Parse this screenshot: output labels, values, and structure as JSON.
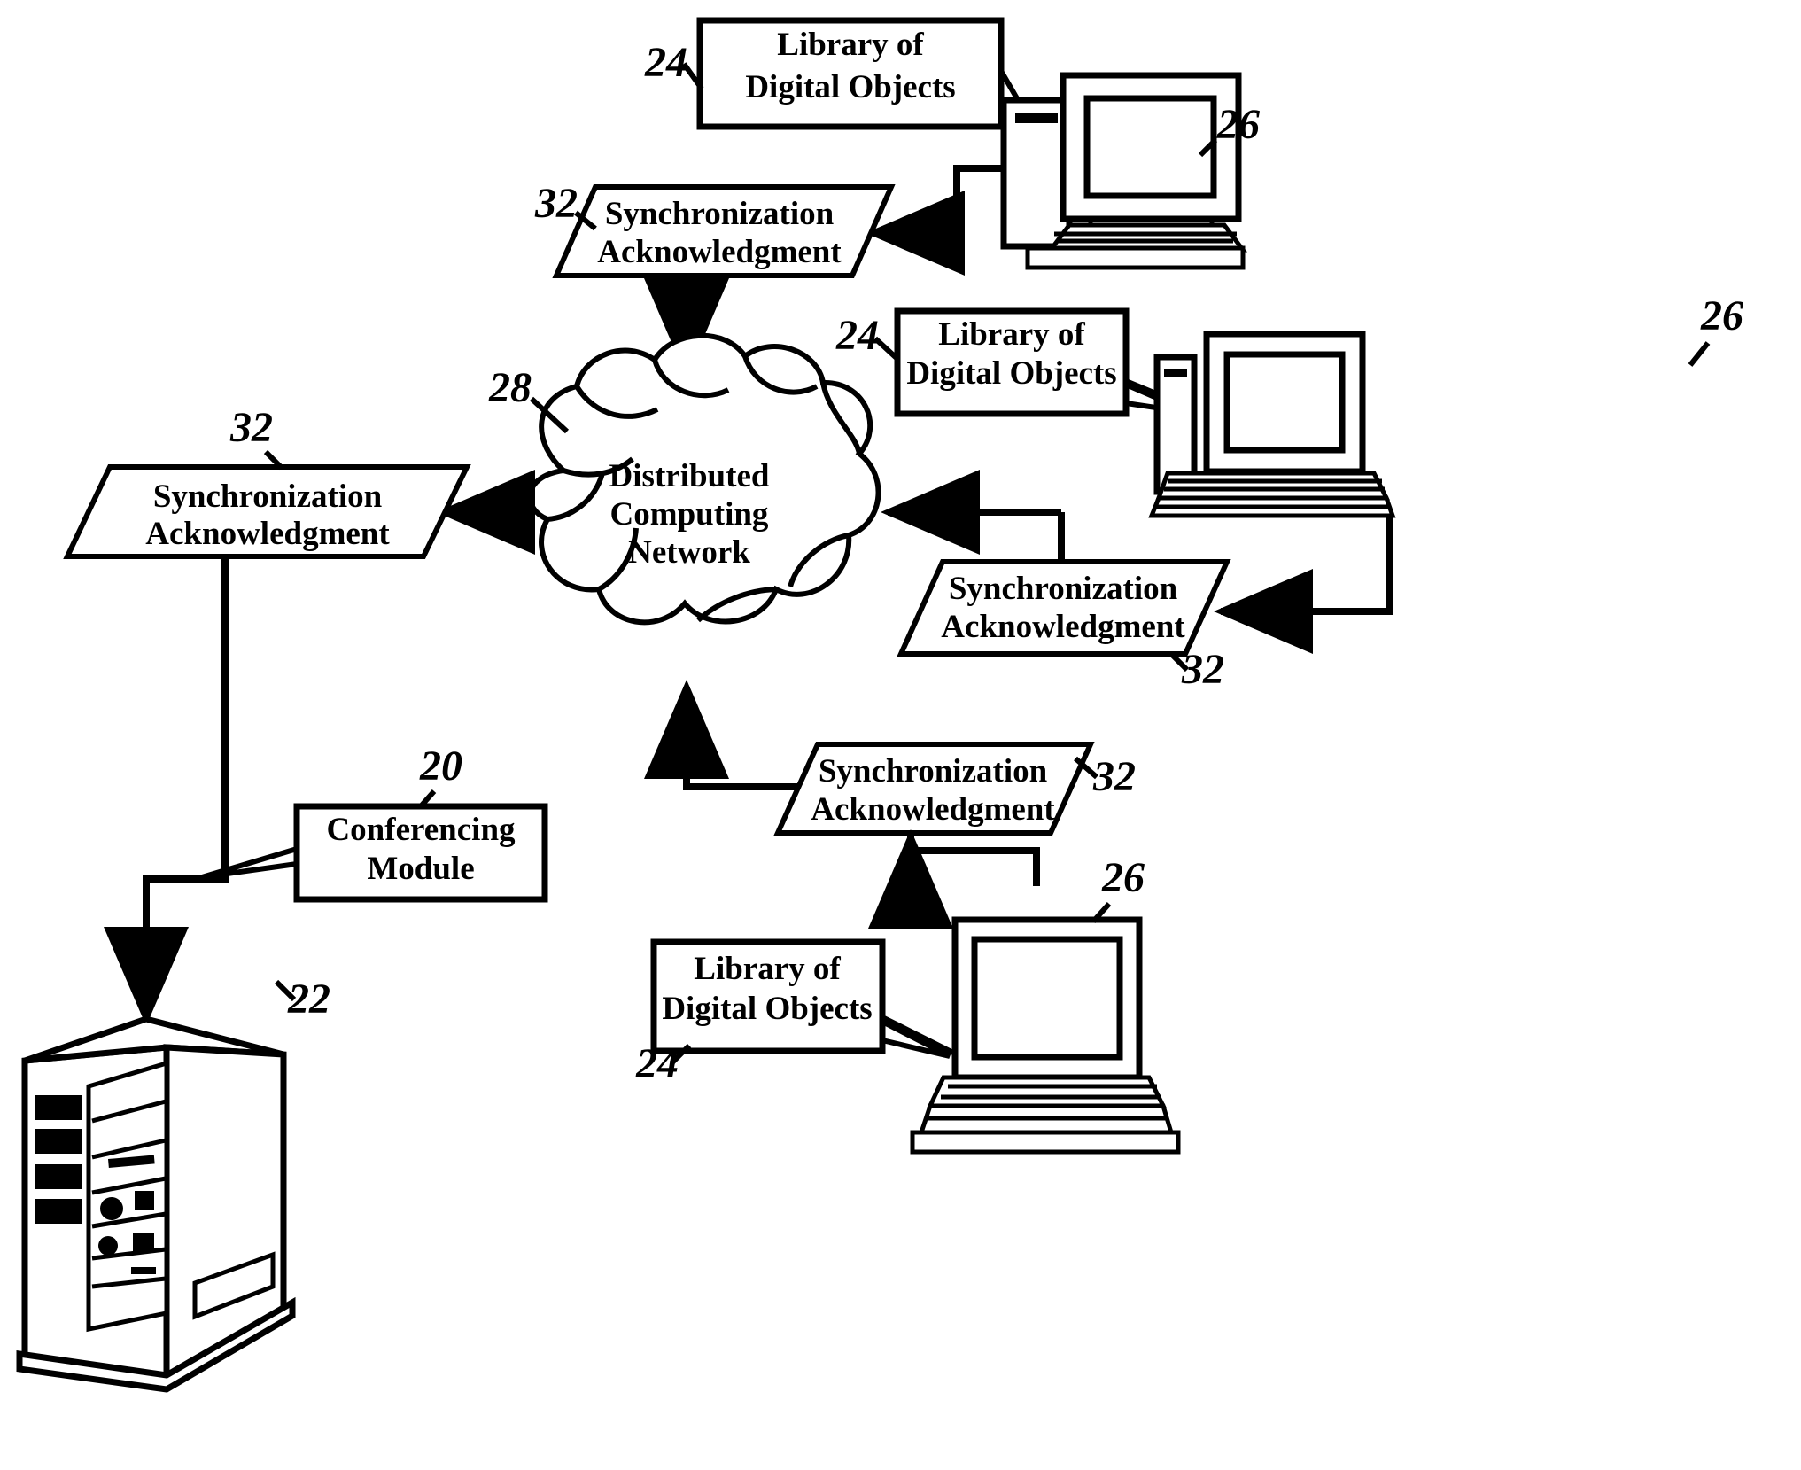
{
  "figure": {
    "type": "patent-figure",
    "background_color": "#ffffff",
    "line_color": "#000000"
  },
  "cloud": {
    "label_lines": [
      "Distributed",
      "Computing",
      "Network"
    ],
    "ref": "28"
  },
  "server": {
    "ref": "22",
    "module": {
      "lines": [
        "Conferencing",
        "Module"
      ],
      "ref": "20"
    }
  },
  "nodes": [
    {
      "id": "desktop-top",
      "kind": "desktop-computer",
      "ref": "26",
      "library": {
        "lines": [
          "Library of",
          "Digital Objects"
        ],
        "ref": "24"
      }
    },
    {
      "id": "laptop-right",
      "kind": "laptop-computer",
      "ref": "26",
      "library": {
        "lines": [
          "Library of",
          "Digital Objects"
        ],
        "ref": "24"
      }
    },
    {
      "id": "laptop-bottom",
      "kind": "laptop-computer",
      "ref": "26",
      "library": {
        "lines": [
          "Library of",
          "Digital Objects"
        ],
        "ref": "24"
      }
    }
  ],
  "sync_messages": [
    {
      "id": "sync-top",
      "lines": [
        "Synchronization",
        "Acknowledgment"
      ],
      "ref": "32"
    },
    {
      "id": "sync-left",
      "lines": [
        "Synchronization",
        "Acknowledgment"
      ],
      "ref": "32"
    },
    {
      "id": "sync-right",
      "lines": [
        "Synchronization",
        "Acknowledgment"
      ],
      "ref": "32"
    },
    {
      "id": "sync-bottom",
      "lines": [
        "Synchronization",
        "Acknowledgment"
      ],
      "ref": "32"
    }
  ]
}
